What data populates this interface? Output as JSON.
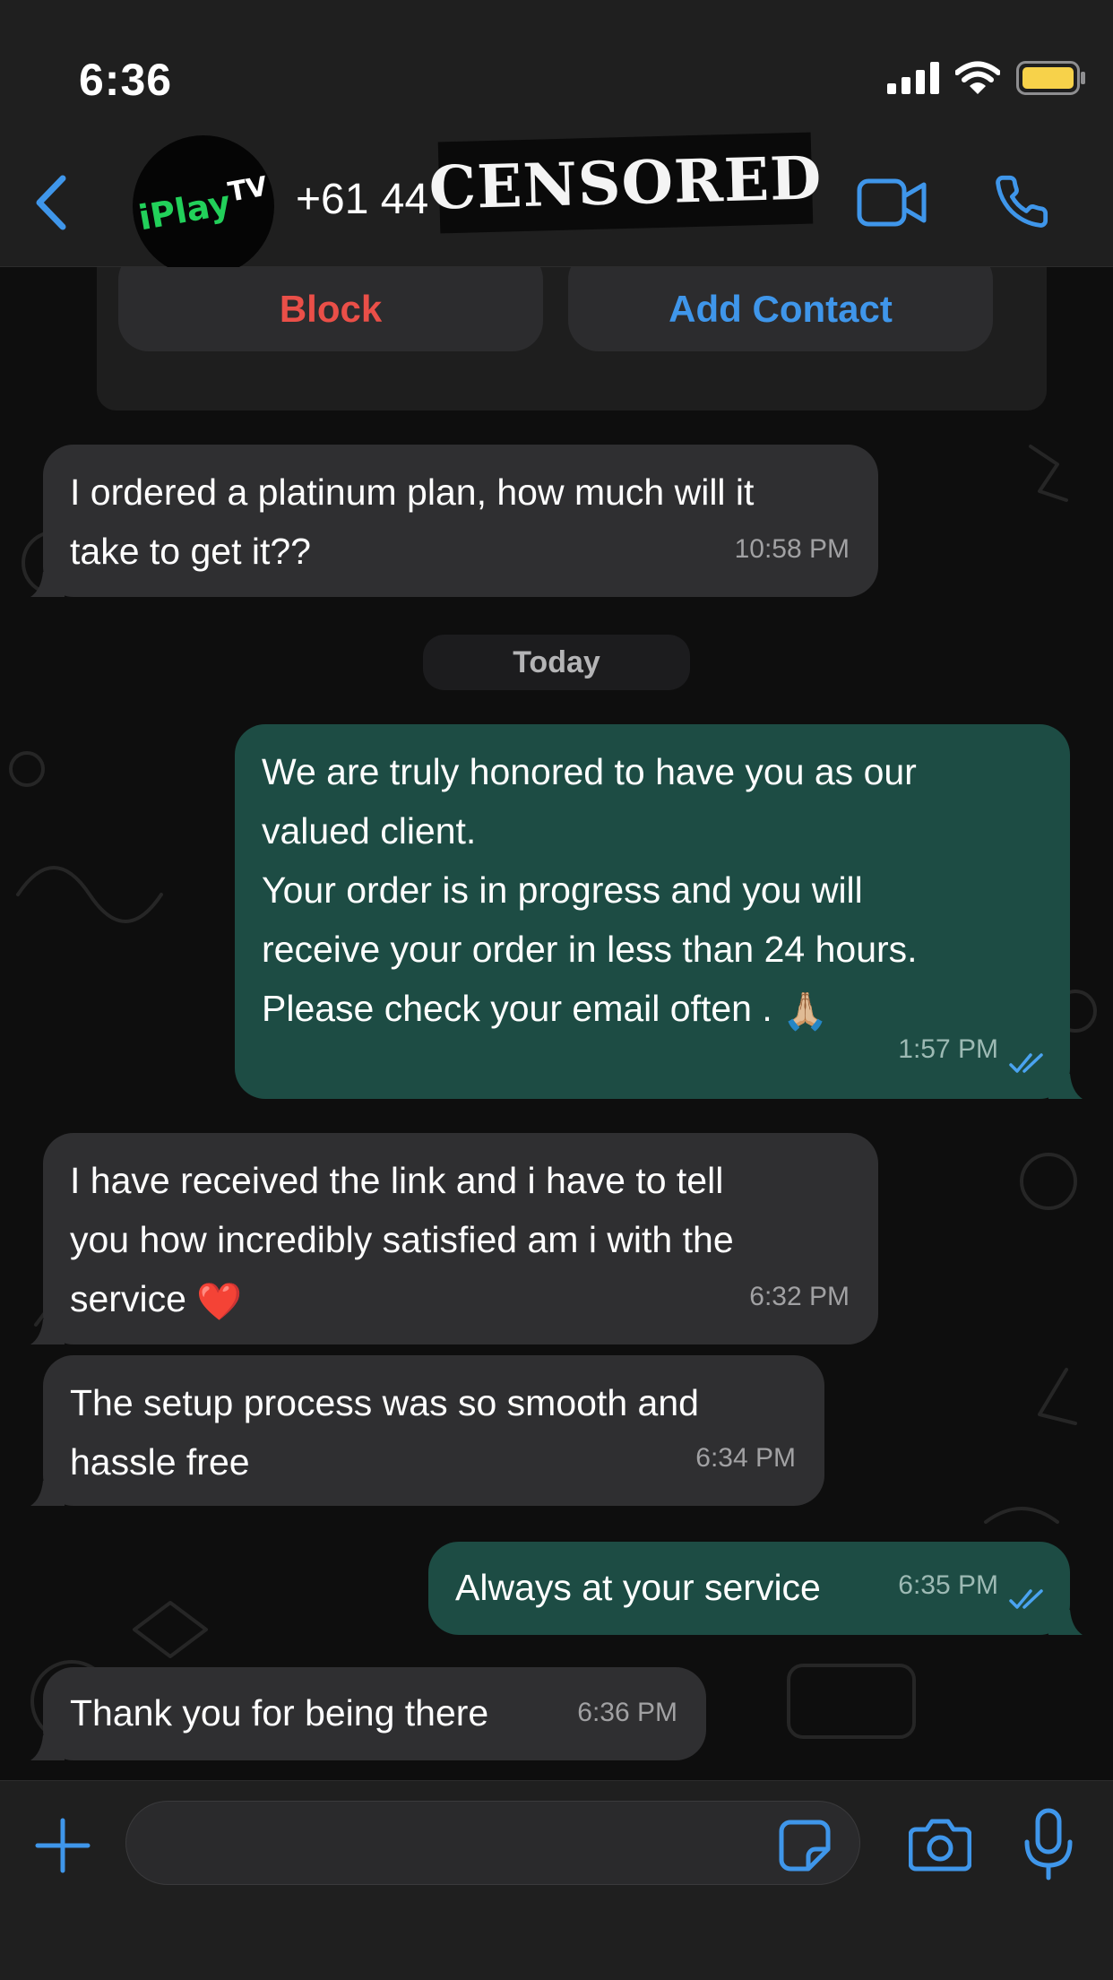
{
  "status_bar": {
    "time": "6:36"
  },
  "header": {
    "avatar": {
      "brand_main": "iPlay",
      "brand_suffix": "TV"
    },
    "contact_name": "+61 44",
    "redaction_label": "CENSORED"
  },
  "contact_card": {
    "block_label": "Block",
    "add_contact_label": "Add Contact"
  },
  "date_separator": "Today",
  "messages": [
    {
      "direction": "incoming",
      "lines": [
        "I ordered a platinum plan, how much will it",
        "take to get it??"
      ],
      "time": "10:58 PM"
    },
    {
      "direction": "outgoing",
      "lines": [
        "We are truly honored to have you as our",
        "valued client.",
        "Your order is in progress and you will",
        "receive your order in less than 24 hours.",
        "Please check your email often ."
      ],
      "emoji": "🙏🏼",
      "time": "1:57 PM",
      "status": "read"
    },
    {
      "direction": "incoming",
      "lines": [
        "I have received the link and i have to tell",
        "you how incredibly satisfied am i with the",
        "service"
      ],
      "emoji": "❤️",
      "time": "6:32 PM"
    },
    {
      "direction": "incoming",
      "lines": [
        "The setup process was so smooth and",
        "hassle free"
      ],
      "time": "6:34 PM"
    },
    {
      "direction": "outgoing",
      "lines": [
        "Always at your service"
      ],
      "time": "6:35 PM",
      "status": "read"
    },
    {
      "direction": "incoming",
      "lines": [
        "Thank you for being there"
      ],
      "time": "6:36 PM"
    }
  ],
  "composer": {
    "value": "",
    "placeholder": ""
  },
  "icons": {
    "back": "chevron-left-icon",
    "video": "video-camera-icon",
    "call": "phone-icon",
    "plus": "plus-icon",
    "sticker": "sticker-icon",
    "camera": "camera-icon",
    "mic": "microphone-icon",
    "read_receipt": "double-check-icon"
  },
  "colors": {
    "accent": "#3f96ea",
    "danger": "#ea4f48",
    "outgoing_bubble": "#1d4c44",
    "incoming_bubble": "#2f2f31",
    "bar_background": "#1f1f1f",
    "read_tick": "#4aa3f0",
    "battery": "#f7d24a",
    "brand_green": "#22d05a"
  }
}
